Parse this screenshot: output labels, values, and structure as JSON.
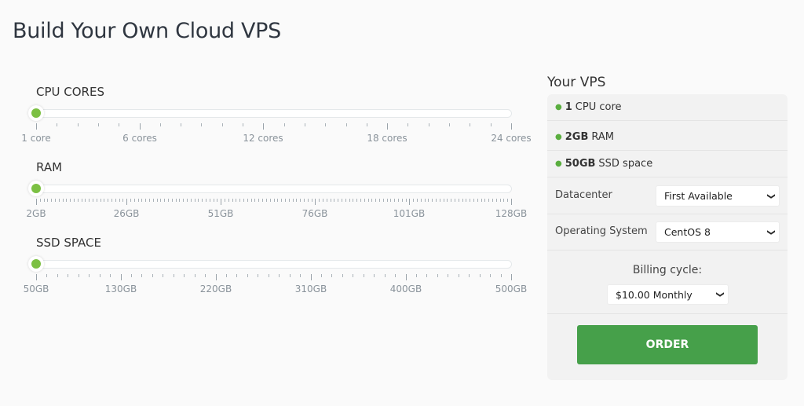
{
  "page": {
    "title": "Build Your Own Cloud VPS"
  },
  "sliders": [
    {
      "id": "cpu",
      "label": "CPU CORES",
      "min": 1,
      "max": 24,
      "step": 1,
      "value": 1,
      "major_ticks": [
        {
          "value": 1,
          "label": "1 core"
        },
        {
          "value": 6,
          "label": "6 cores"
        },
        {
          "value": 12,
          "label": "12 cores"
        },
        {
          "value": 18,
          "label": "18 cores"
        },
        {
          "value": 24,
          "label": "24 cores"
        }
      ]
    },
    {
      "id": "ram",
      "label": "RAM",
      "min": 2,
      "max": 128,
      "step": 1,
      "value": 2,
      "major_ticks": [
        {
          "value": 2,
          "label": "2GB"
        },
        {
          "value": 26,
          "label": "26GB"
        },
        {
          "value": 51,
          "label": "51GB"
        },
        {
          "value": 76,
          "label": "76GB"
        },
        {
          "value": 101,
          "label": "101GB"
        },
        {
          "value": 128,
          "label": "128GB"
        }
      ]
    },
    {
      "id": "ssd",
      "label": "SSD SPACE",
      "min": 50,
      "max": 500,
      "step": 10,
      "value": 50,
      "major_ticks": [
        {
          "value": 50,
          "label": "50GB"
        },
        {
          "value": 130,
          "label": "130GB"
        },
        {
          "value": 220,
          "label": "220GB"
        },
        {
          "value": 310,
          "label": "310GB"
        },
        {
          "value": 400,
          "label": "400GB"
        },
        {
          "value": 500,
          "label": "500GB"
        }
      ]
    }
  ],
  "summary": {
    "title": "Your VPS",
    "specs": [
      {
        "value": "1",
        "unit": "CPU core"
      },
      {
        "value": "2GB",
        "unit": "RAM"
      },
      {
        "value": "50GB",
        "unit": "SSD space"
      }
    ],
    "datacenter": {
      "label": "Datacenter",
      "selected": "First Available"
    },
    "os": {
      "label": "Operating System",
      "selected": "CentOS 8"
    },
    "billing": {
      "label": "Billing cycle:",
      "selected": "$10.00 Monthly"
    },
    "order_label": "ORDER",
    "accent_color": "#7cc043",
    "button_color": "#46a04a"
  }
}
